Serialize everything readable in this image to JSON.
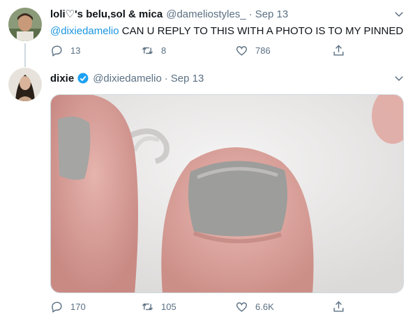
{
  "tweets": [
    {
      "display_name": "loli♡'s belu,sol & mica",
      "handle": "@dameliostyles_",
      "separator": "·",
      "date": "Sep 13",
      "mention": "@dixiedamelio",
      "text": "CAN U REPLY TO THIS WITH A PHOTO IS TO MY PINNED",
      "replies": "13",
      "retweets": "8",
      "likes": "786"
    },
    {
      "display_name": "dixie",
      "verified": true,
      "handle": "@dixiedamelio",
      "separator": "·",
      "date": "Sep 13",
      "replies": "170",
      "retweets": "105",
      "likes": "6.6K"
    }
  ],
  "colors": {
    "mention": "#1b95e0",
    "muted": "#5b7083",
    "verified": "#1da1f2"
  },
  "icons": [
    "reply-icon",
    "retweet-icon",
    "like-icon",
    "share-icon",
    "caret-down-icon",
    "verified-badge-icon"
  ]
}
